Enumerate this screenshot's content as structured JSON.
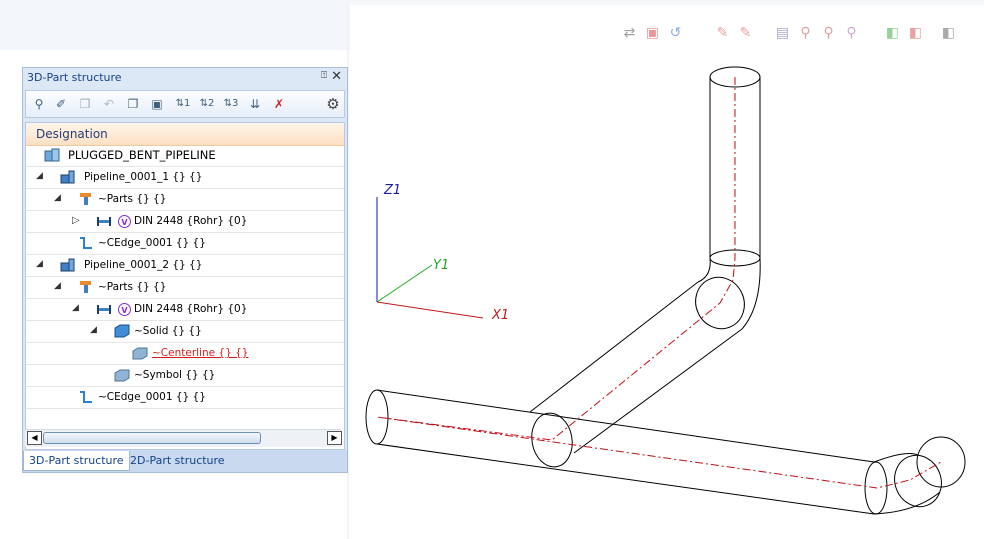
{
  "panel": {
    "title": "3D-Part structure",
    "pin_glyph": "⍐",
    "close_glyph": "✕",
    "column_header": "Designation",
    "tabs": [
      "3D-Part structure",
      "2D-Part structure"
    ]
  },
  "toolbar_icons": [
    "find-icon",
    "assign-icon",
    "copy-icon",
    "undo-icon",
    "paste-icon",
    "clipboard-icon",
    "sort-1-icon",
    "sort-2-icon",
    "sort-3-icon",
    "sort-down-icon",
    "delete-attribute-icon",
    "settings-icon"
  ],
  "tree": {
    "root_label": "PLUGGED_BENT_PIPELINE",
    "rows": [
      {
        "label": "Pipeline_0001_1 {} {}",
        "icon": "pipeline-icon"
      },
      {
        "label": "~Parts {} {}",
        "icon": "parts-icon"
      },
      {
        "label": "DIN 2448 {Rohr} {0}",
        "icon": "pipe-part-icon"
      },
      {
        "label": "~CEdge_0001 {} {}",
        "icon": "edge-icon"
      },
      {
        "label": "Pipeline_0001_2 {} {}",
        "icon": "pipeline-icon"
      },
      {
        "label": "~Parts {} {}",
        "icon": "parts-icon"
      },
      {
        "label": "DIN 2448 {Rohr} {0}",
        "icon": "pipe-part-icon"
      },
      {
        "label": "~Solid {} {}",
        "icon": "solid-icon"
      },
      {
        "label": "~Centerline {} {}",
        "icon": "centerline-icon"
      },
      {
        "label": "~Symbol {} {}",
        "icon": "symbol-icon"
      },
      {
        "label": "~CEdge_0001 {} {}",
        "icon": "edge-icon"
      }
    ],
    "variant_badge": "V"
  },
  "viewport": {
    "axis_labels": {
      "z": "Z1",
      "y": "Y1",
      "x": "X1"
    },
    "colors": {
      "z_axis": "#1a1aa6",
      "y_axis": "#1faa1f",
      "x_axis": "#c01818",
      "centerline": "#c0101a",
      "edges": "#000000"
    }
  },
  "view_toolbar_icons": [
    "swap-icon",
    "box-icon",
    "undo-icon",
    "measure-icon",
    "measure2-icon",
    "doc-icon",
    "zoom-icon",
    "zoom2-icon",
    "zoom3-icon",
    "cube-icon",
    "cube2-icon",
    "cube3-icon"
  ]
}
